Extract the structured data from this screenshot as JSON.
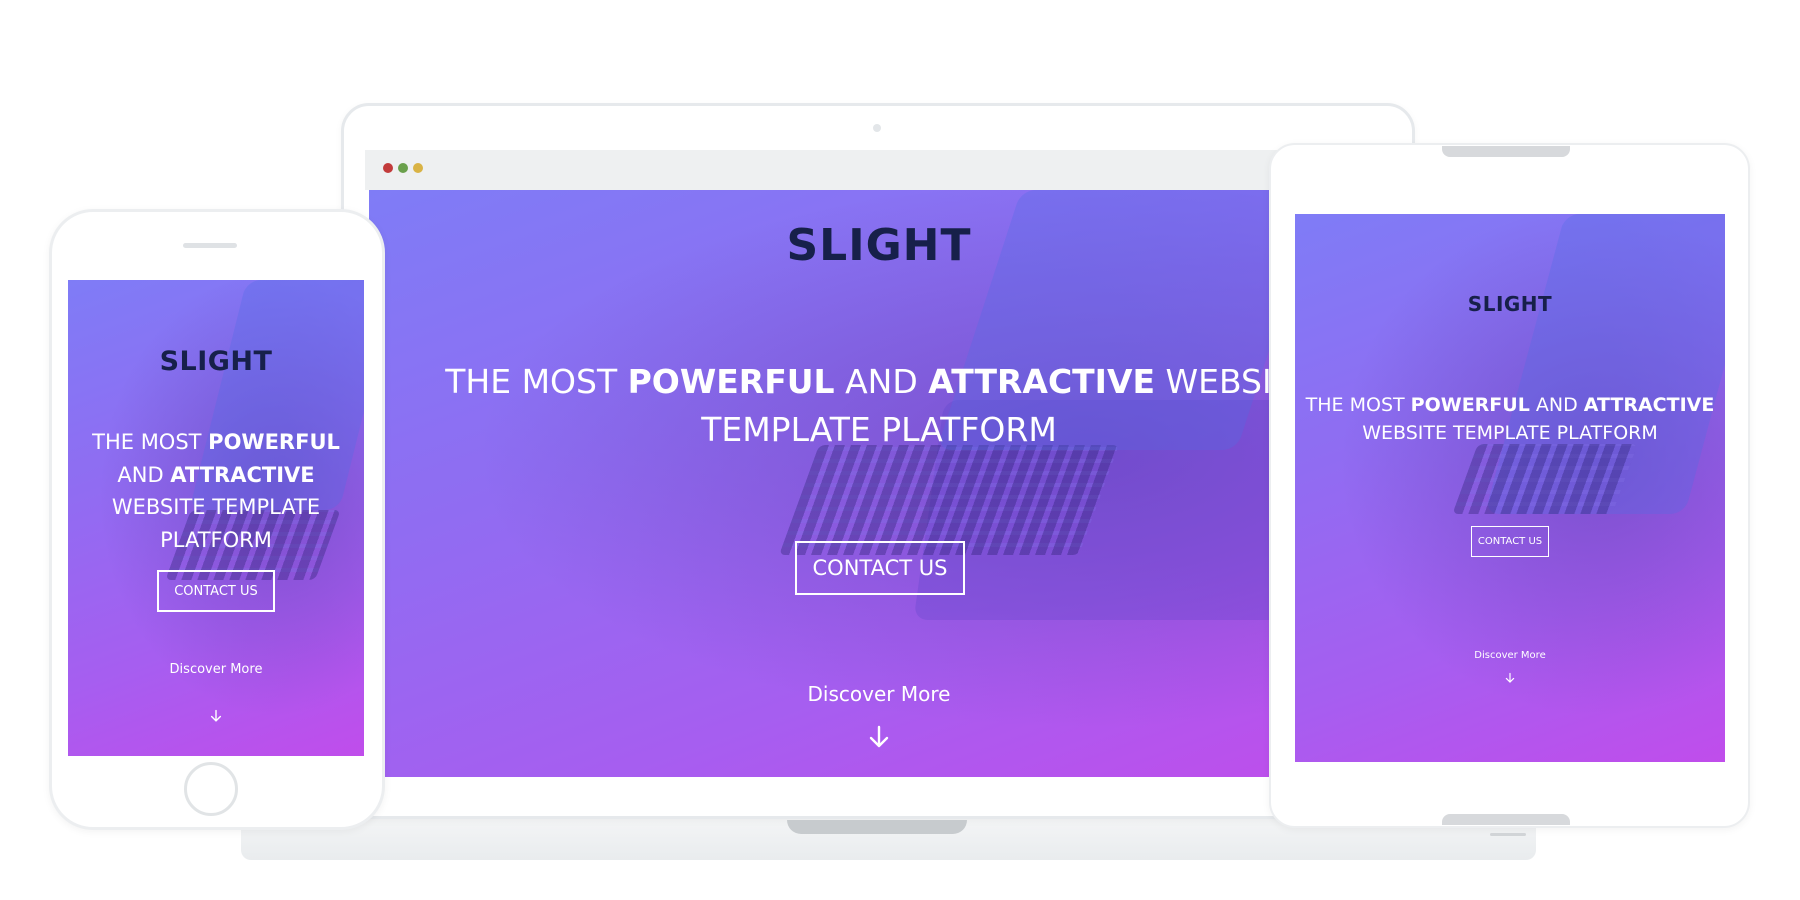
{
  "brand": "SLIGHT",
  "headline": {
    "part1": "THE MOST ",
    "strong1": "POWERFUL",
    "part2": " AND ",
    "strong2": "ATTRACTIVE",
    "part3": " WEBSITE TEMPLATE PLATFORM"
  },
  "cta_label": "CONTACT US",
  "discover_label": "Discover More",
  "icons": {
    "arrow": "arrow-down-icon"
  },
  "colors": {
    "gradient_start": "#7f7cf6",
    "gradient_mid": "#a65ef0",
    "gradient_end": "#c04deb",
    "brand_text": "#17204a",
    "window_close": "#c23b3b",
    "window_maximize": "#6aa04c",
    "window_minimize": "#d9b345"
  }
}
